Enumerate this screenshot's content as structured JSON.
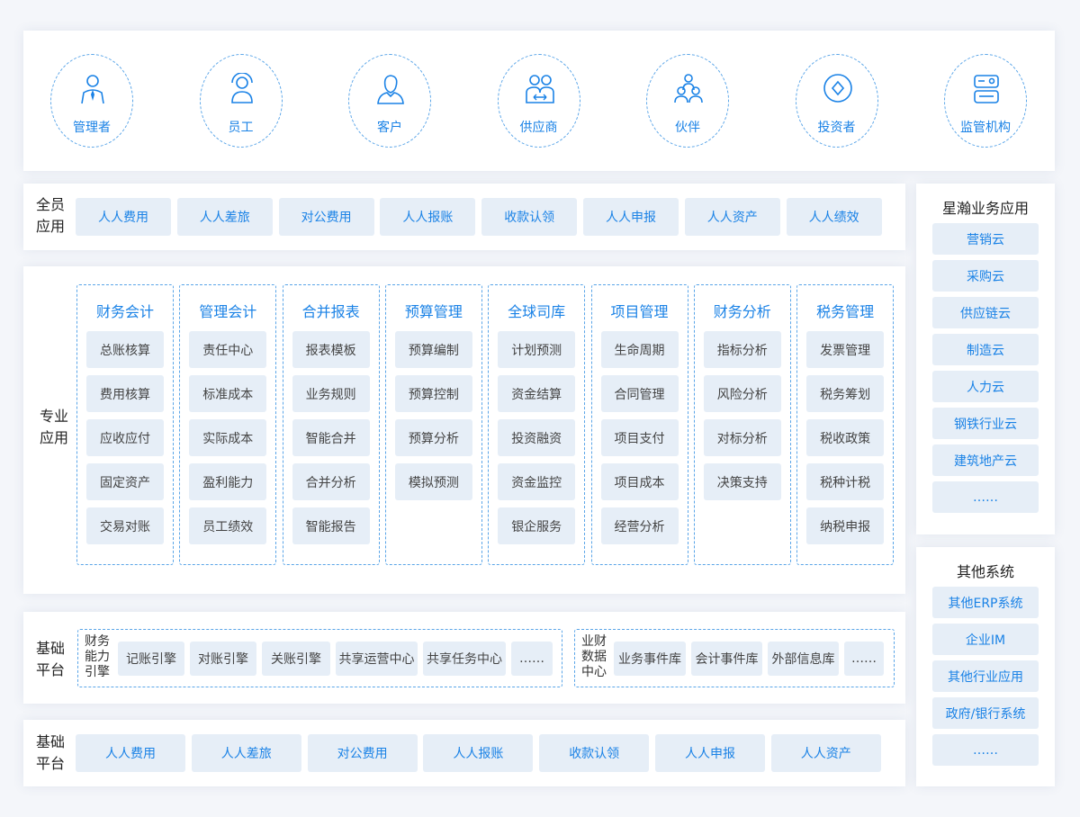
{
  "roles": [
    {
      "label": "管理者",
      "icon": "manager-icon"
    },
    {
      "label": "员工",
      "icon": "employee-icon"
    },
    {
      "label": "客户",
      "icon": "customer-icon"
    },
    {
      "label": "供应商",
      "icon": "supplier-icon"
    },
    {
      "label": "伙伴",
      "icon": "partner-icon"
    },
    {
      "label": "投资者",
      "icon": "investor-icon"
    },
    {
      "label": "监管机构",
      "icon": "regulator-icon"
    }
  ],
  "all_staff": {
    "label": "全员\n应用",
    "items": [
      "人人费用",
      "人人差旅",
      "对公费用",
      "人人报账",
      "收款认领",
      "人人申报",
      "人人资产",
      "人人绩效"
    ]
  },
  "professional": {
    "label": "专业\n应用",
    "columns": [
      {
        "title": "财务会计",
        "items": [
          "总账核算",
          "费用核算",
          "应收应付",
          "固定资产",
          "交易对账"
        ]
      },
      {
        "title": "管理会计",
        "items": [
          "责任中心",
          "标准成本",
          "实际成本",
          "盈利能力",
          "员工绩效"
        ]
      },
      {
        "title": "合并报表",
        "items": [
          "报表模板",
          "业务规则",
          "智能合并",
          "合并分析",
          "智能报告"
        ]
      },
      {
        "title": "预算管理",
        "items": [
          "预算编制",
          "预算控制",
          "预算分析",
          "模拟预测"
        ]
      },
      {
        "title": "全球司库",
        "items": [
          "计划预测",
          "资金结算",
          "投资融资",
          "资金监控",
          "银企服务"
        ]
      },
      {
        "title": "项目管理",
        "items": [
          "生命周期",
          "合同管理",
          "项目支付",
          "项目成本",
          "经营分析"
        ]
      },
      {
        "title": "财务分析",
        "items": [
          "指标分析",
          "风险分析",
          "对标分析",
          "决策支持"
        ]
      },
      {
        "title": "税务管理",
        "items": [
          "发票管理",
          "税务筹划",
          "税收政策",
          "税种计税",
          "纳税申报"
        ]
      }
    ]
  },
  "foundation": {
    "label": "基础\n平台",
    "group1": {
      "label": "财务\n能力\n引擎",
      "items": [
        "记账引擎",
        "对账引擎",
        "关账引擎",
        "共享运营中心",
        "共享任务中心",
        "……"
      ]
    },
    "group2": {
      "label": "业财\n数据\n中心",
      "items": [
        "业务事件库",
        "会计事件库",
        "外部信息库",
        "……"
      ]
    }
  },
  "bottom": {
    "label": "基础\n平台",
    "items": [
      "人人费用",
      "人人差旅",
      "对公费用",
      "人人报账",
      "收款认领",
      "人人申报",
      "人人资产"
    ]
  },
  "xinghan": {
    "title": "星瀚业务应用",
    "items": [
      "营销云",
      "采购云",
      "供应链云",
      "制造云",
      "人力云",
      "钢铁行业云",
      "建筑地产云",
      "……"
    ]
  },
  "other": {
    "title": "其他系统",
    "items": [
      "其他ERP系统",
      "企业IM",
      "其他行业应用",
      "政府/银行系统",
      "……"
    ]
  }
}
